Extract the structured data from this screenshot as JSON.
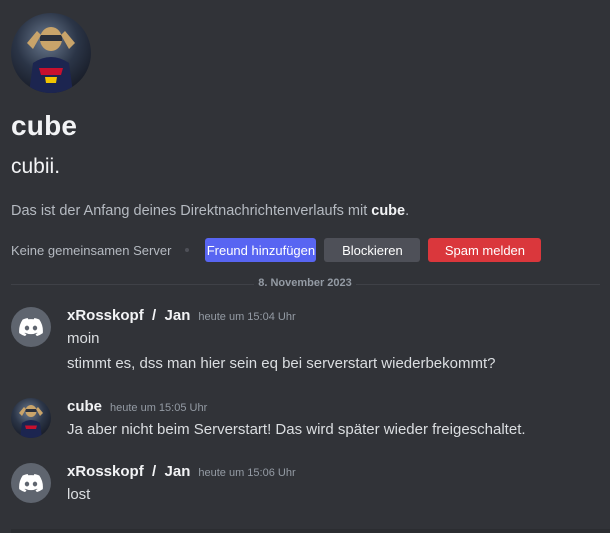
{
  "profile": {
    "display_name": "cube",
    "username": "cubii.",
    "intro_prefix": "Das ist der Anfang deines Direktnachrichtenverlaufs mit ",
    "intro_name": "cube",
    "intro_suffix": "."
  },
  "actions": {
    "no_servers": "Keine gemeinsamen Server",
    "add_friend": "Freund hinzufügen",
    "block": "Blockieren",
    "report_spam": "Spam melden"
  },
  "divider_date": "8. November 2023",
  "messages": [
    {
      "author": "xRosskopf  /  Jan",
      "timestamp": "heute um 15:04 Uhr",
      "avatar": "discord-default-icon",
      "lines": [
        "moin",
        "stimmt es, dss man hier sein eq bei serverstart wiederbekommt?"
      ]
    },
    {
      "author": "cube",
      "timestamp": "heute um 15:05 Uhr",
      "avatar": "profile-photo",
      "lines": [
        "Ja aber nicht beim Serverstart! Das wird später wieder freigeschaltet."
      ]
    },
    {
      "author": "xRosskopf  /  Jan",
      "timestamp": "heute um 15:06 Uhr",
      "avatar": "discord-default-icon",
      "lines": [
        "lost"
      ]
    }
  ],
  "colors": {
    "background": "#313338",
    "primary_button": "#5865f2",
    "secondary_button": "#4e5058",
    "danger_button": "#da373c"
  }
}
